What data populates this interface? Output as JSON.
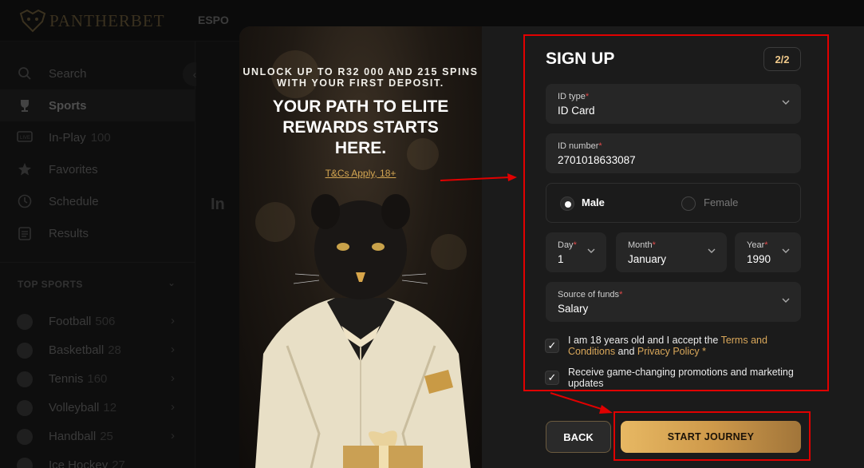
{
  "brand": {
    "name": "PANTHERBET"
  },
  "topnav": {
    "label": "ESPO"
  },
  "sidebar": {
    "items": [
      {
        "label": "Search",
        "count": "",
        "icon": "search-icon"
      },
      {
        "label": "Sports",
        "count": "",
        "icon": "trophy-icon"
      },
      {
        "label": "In-Play",
        "count": "100",
        "icon": "live-icon"
      },
      {
        "label": "Favorites",
        "count": "",
        "icon": "star-icon"
      },
      {
        "label": "Schedule",
        "count": "",
        "icon": "clock-icon"
      },
      {
        "label": "Results",
        "count": "",
        "icon": "clipboard-icon"
      }
    ],
    "top_sports_heading": "TOP SPORTS",
    "sports": [
      {
        "label": "Football",
        "count": "506"
      },
      {
        "label": "Basketball",
        "count": "28"
      },
      {
        "label": "Tennis",
        "count": "160"
      },
      {
        "label": "Volleyball",
        "count": "12"
      },
      {
        "label": "Handball",
        "count": "25"
      },
      {
        "label": "Ice Hockey",
        "count": "27"
      }
    ]
  },
  "background": {
    "heading": "In"
  },
  "promo": {
    "subtitle": "UNLOCK UP TO R32 000 AND 215 SPINS WITH YOUR FIRST DEPOSIT.",
    "title": "YOUR PATH TO ELITE REWARDS STARTS HERE.",
    "terms": "T&Cs Apply, 18+"
  },
  "signup": {
    "title": "SIGN UP",
    "step": "2/2",
    "id_type": {
      "label": "ID type",
      "value": "ID Card"
    },
    "id_number": {
      "label": "ID number",
      "value": "2701018633087"
    },
    "gender": {
      "male": "Male",
      "female": "Female",
      "selected": "Male"
    },
    "day": {
      "label": "Day",
      "value": "1"
    },
    "month": {
      "label": "Month",
      "value": "January"
    },
    "year": {
      "label": "Year",
      "value": "1990"
    },
    "source_of_funds": {
      "label": "Source of funds",
      "value": "Salary"
    },
    "required_mark": "*",
    "age_check": {
      "checked": true,
      "text_before": "I am 18 years old and I accept the ",
      "terms_link": "Terms and Conditions",
      "and": " and ",
      "privacy_link": "Privacy Policy",
      "required": " *"
    },
    "promo_check": {
      "checked": true,
      "text": "Receive game-changing promotions and marketing updates"
    },
    "back_button": "BACK",
    "start_button": "START JOURNEY"
  },
  "colors": {
    "accent_gold": "#d9a75a",
    "annotation_red": "#e10000",
    "required_red": "#e04a4a"
  }
}
